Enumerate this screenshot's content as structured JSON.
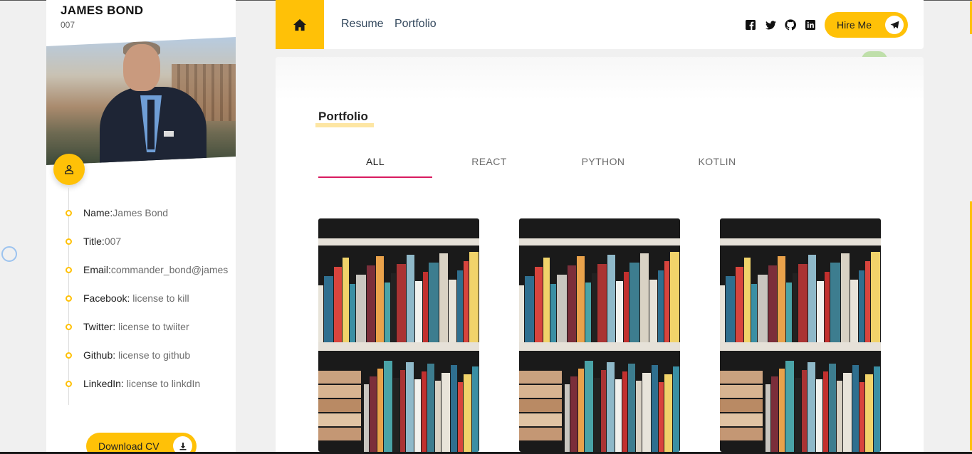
{
  "sidebar": {
    "name": "JAMES BOND",
    "code": "007",
    "info": [
      {
        "label": "Name:",
        "value": "James Bond"
      },
      {
        "label": "Title:",
        "value": "007"
      },
      {
        "label": "Email:",
        "value": "commander_bond@james"
      },
      {
        "label": "Facebook:",
        "value": " license to kill"
      },
      {
        "label": "Twitter:",
        "value": " license to twiiter"
      },
      {
        "label": "Github:",
        "value": " license to github"
      },
      {
        "label": "LinkedIn:",
        "value": " license to linkdIn"
      }
    ],
    "download_label": "Download CV"
  },
  "header": {
    "nav": [
      "Resume",
      "Portfolio"
    ],
    "socials": [
      "facebook-icon",
      "twitter-icon",
      "github-icon",
      "linkedin-icon"
    ],
    "hire_label": "Hire Me"
  },
  "main": {
    "title": "Portfolio",
    "tabs": [
      "ALL",
      "REACT",
      "PYTHON",
      "KOTLIN"
    ],
    "active_tab": "ALL",
    "cards": 3
  },
  "colors": {
    "accent": "#ffc107",
    "tab_indicator": "#d81b60",
    "title_highlight": "#fde6a3"
  }
}
